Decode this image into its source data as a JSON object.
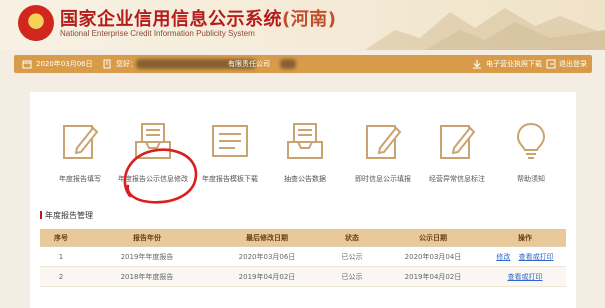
{
  "header": {
    "title": "国家企业信用信息公示系统",
    "region": "(河南)",
    "subtitle": "National Enterprise Credit Information Publicity System"
  },
  "topbar": {
    "date": "2020年03月06日",
    "company_prefix": "您好：",
    "company_suffix": "有限责任公司",
    "download_label": "电子营业执照下载",
    "logout_label": "退出登录"
  },
  "tools": [
    {
      "label": "年度报告填写",
      "icon": "pencil-clipboard-icon"
    },
    {
      "label": "年度报告公示信息修改",
      "icon": "inbox-tray-icon"
    },
    {
      "label": "年度报告模板下载",
      "icon": "document-list-icon"
    },
    {
      "label": "抽查公告数据",
      "icon": "inbox-list-icon"
    },
    {
      "label": "即时信息公示填报",
      "icon": "pencil-clipboard-icon"
    },
    {
      "label": "经营异常信息标注",
      "icon": "pencil-clipboard-icon"
    },
    {
      "label": "帮助须知",
      "icon": "lightbulb-icon"
    }
  ],
  "section": {
    "title": "年度报告管理"
  },
  "table": {
    "headers": [
      "序号",
      "报告年份",
      "最后修改日期",
      "状态",
      "公示日期",
      "操作"
    ],
    "rows": [
      {
        "no": "1",
        "year": "2019年年度报告",
        "modified": "2020年03月06日",
        "status": "已公示",
        "published": "2020年03月04日",
        "action1": "修改",
        "action2": "查看或打印"
      },
      {
        "no": "2",
        "year": "2018年年度报告",
        "modified": "2019年04月02日",
        "status": "已公示",
        "published": "2019年04月02日",
        "action1": "",
        "action2": "查看或打印"
      }
    ]
  },
  "annotation": {
    "color": "#d8201f"
  },
  "colors": {
    "brand_red": "#b51d1d",
    "toolbar": "#d79b4a",
    "table_header": "#e8c99a",
    "link": "#2f67c8"
  }
}
